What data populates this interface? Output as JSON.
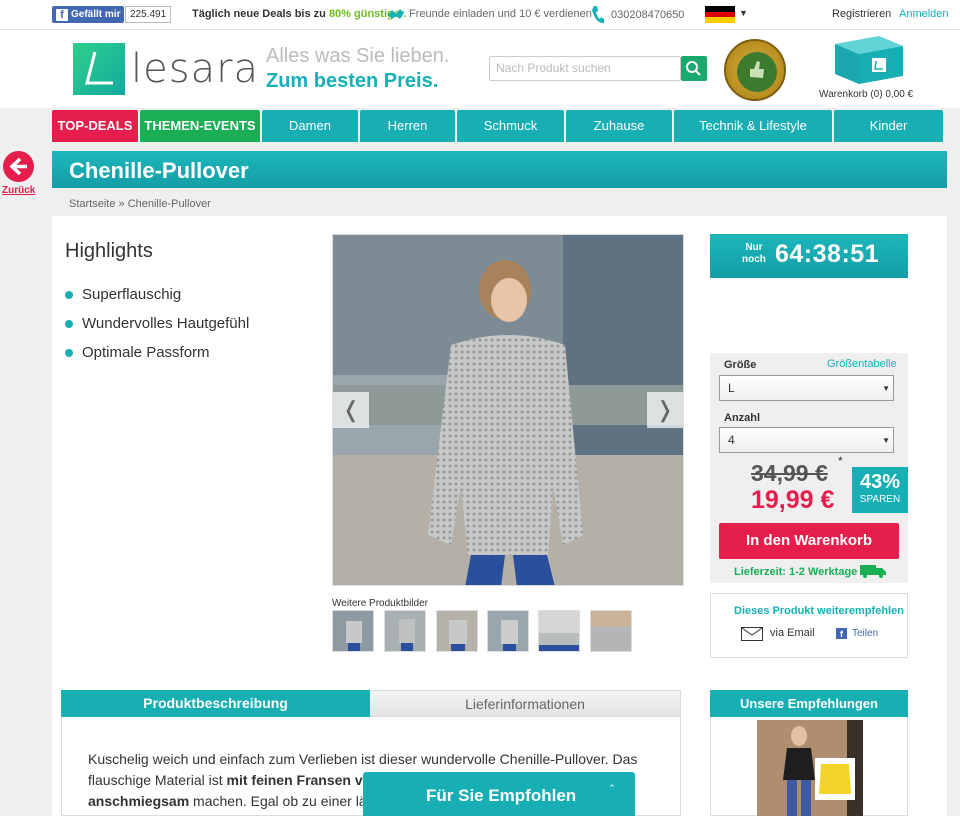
{
  "topbar": {
    "fb_like_label": "Gefällt mir",
    "fb_like_count": "225.491",
    "deals_prefix": "Täglich neue Deals bis zu",
    "deals_highlight": "80% günstiger.",
    "invite_text": "Freunde einladen und 10 € verdienen",
    "phone_number": "030208470650",
    "register_label": "Registrieren",
    "login_label": "Anmelden"
  },
  "header": {
    "logo_text": "lesara",
    "slogan_line1": "Alles was Sie lieben.",
    "slogan_line2": "Zum besten Preis.",
    "search_placeholder": "Nach Produkt suchen",
    "cart_label": "Warenkorb (0) 0,00 €"
  },
  "nav": {
    "items": [
      {
        "label": "TOP-DEALS",
        "kind": "top"
      },
      {
        "label": "THEMEN-EVENTS",
        "kind": "events"
      },
      {
        "label": "Damen",
        "kind": "cat"
      },
      {
        "label": "Herren",
        "kind": "cat"
      },
      {
        "label": "Schmuck",
        "kind": "cat"
      },
      {
        "label": "Zuhause",
        "kind": "cat"
      },
      {
        "label": "Technik & Lifestyle",
        "kind": "cat"
      },
      {
        "label": "Kinder",
        "kind": "cat"
      }
    ]
  },
  "back": {
    "label": "Zurück"
  },
  "product": {
    "title": "Chenille-Pullover",
    "breadcrumb": "Startseite » Chenille-Pullover",
    "highlights_title": "Highlights",
    "highlights": [
      "Superflauschig",
      "Wundervolles Hautgefühl",
      "Optimale Passform"
    ],
    "more_images_label": "Weitere Produktbilder",
    "prev_arrow": "❬",
    "next_arrow": "❭"
  },
  "timer": {
    "prefix_line1": "Nur",
    "prefix_line2": "noch",
    "value": "64:38:51"
  },
  "buybox": {
    "size_label": "Größe",
    "size_table_link": "Größentabelle",
    "size_value": "L",
    "qty_label": "Anzahl",
    "qty_value": "4",
    "old_price": "34,99 €",
    "asterisk": "*",
    "new_price": "19,99 €",
    "save_pct": "43%",
    "save_label": "SPAREN",
    "cart_button": "In den Warenkorb",
    "delivery_text": "Lieferzeit: 1-2 Werktage"
  },
  "share": {
    "title": "Dieses Produkt weiterempfehlen",
    "email_label": "via Email",
    "share_label": "Teilen"
  },
  "tabs": {
    "description_tab": "Produktbeschreibung",
    "delivery_tab": "Lieferinformationen"
  },
  "description": {
    "line1": "Kuschelig weich und einfach zum Verlieben ist dieser wundervolle Chenille-Pullover. Das",
    "line2_a": "flauschige Material ist ",
    "line2_b": "mit feinen Fransen ve",
    "line2_c": "nd",
    "line3_a": "anschmiegsam",
    "line3_b": " machen. Egal ob zu einer läs",
    "line3_c": "er"
  },
  "recommendations": {
    "title": "Unsere Empfehlungen"
  },
  "floating": {
    "label": "Für Sie Empfohlen",
    "caret": "ˆ"
  },
  "colors": {
    "teal": "#17aeb4",
    "red": "#e61e4d",
    "green": "#1aae55"
  }
}
